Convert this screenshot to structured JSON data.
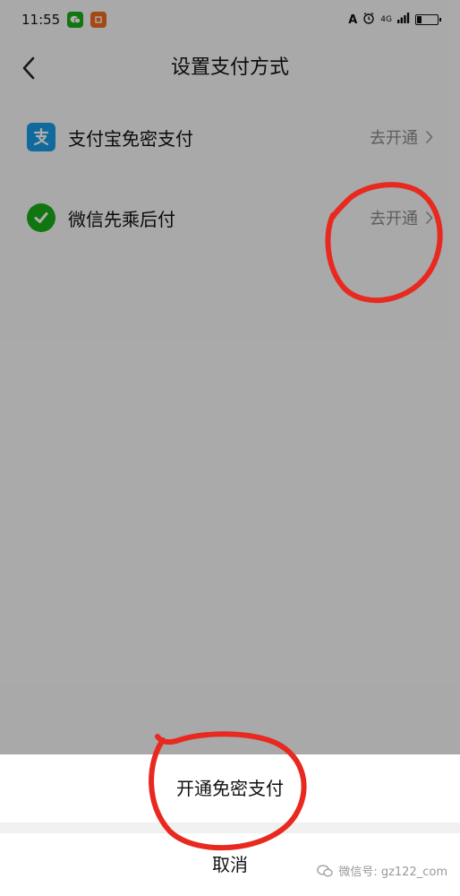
{
  "status_bar": {
    "time": "11:55",
    "signal_text": "4G"
  },
  "nav": {
    "title": "设置支付方式"
  },
  "payment_methods": [
    {
      "label": "支付宝免密支付",
      "action": "去开通",
      "icon": "alipay-icon",
      "color": "#1A9BE6"
    },
    {
      "label": "微信先乘后付",
      "action": "去开通",
      "icon": "wechat-pay-icon",
      "color": "#1AAD19"
    }
  ],
  "sheet": {
    "primary_label": "开通免密支付",
    "cancel_label": "取消"
  },
  "watermark": {
    "text": "微信号: gz122_com"
  },
  "colors": {
    "alipay": "#1A9BE6",
    "wechat": "#1AAD19",
    "annotation": "#E8291F"
  }
}
